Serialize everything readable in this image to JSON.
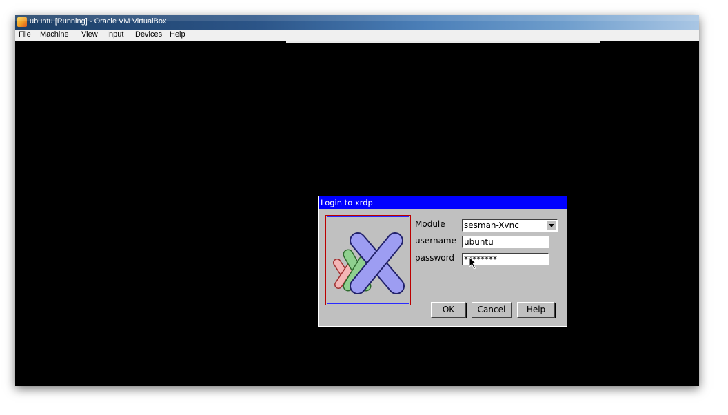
{
  "window": {
    "title": "ubuntu [Running] - Oracle VM VirtualBox",
    "app_icon": "virtualbox-icon"
  },
  "menubar": {
    "items": [
      "File",
      "Machine",
      "View",
      "Input",
      "Devices",
      "Help"
    ]
  },
  "dialog": {
    "title": "Login to xrdp",
    "logo": "xrdp-logo",
    "module_label": "Module",
    "module_value": "sesman-Xvnc",
    "username_label": "username",
    "username_value": "ubuntu",
    "password_label": "password",
    "password_value": "********",
    "ok_label": "OK",
    "cancel_label": "Cancel",
    "help_label": "Help"
  },
  "colors": {
    "titlebar": "#2b5487",
    "dialog_titlebar": "#0000ff",
    "dialog_bg": "#c0c0c0",
    "guest_bg": "#000000"
  }
}
